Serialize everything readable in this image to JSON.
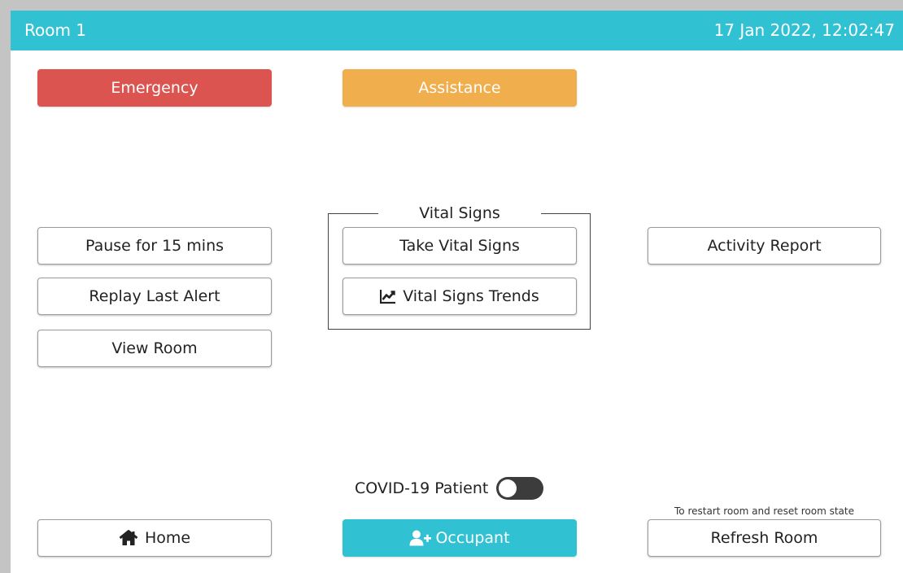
{
  "header": {
    "room": "Room 1",
    "datetime": "17 Jan 2022, 12:02:47"
  },
  "actions": {
    "emergency": "Emergency",
    "assistance": "Assistance"
  },
  "left": {
    "pause": "Pause for 15 mins",
    "replay": "Replay Last Alert",
    "view_room": "View Room"
  },
  "vital_signs": {
    "title": "Vital Signs",
    "take": "Take Vital Signs",
    "trends": "Vital Signs Trends"
  },
  "right": {
    "activity_report": "Activity Report"
  },
  "covid": {
    "label": "COVID-19 Patient",
    "enabled": false
  },
  "bottom": {
    "home": "Home",
    "occupant": "Occupant",
    "refresh_hint": "To restart room and reset room state",
    "refresh": "Refresh Room"
  },
  "colors": {
    "header": "#30c1d3",
    "emergency": "#dc5450",
    "assistance": "#f0ae4d",
    "occupant": "#30c1d3"
  },
  "icons": {
    "trends": "chart-line-icon",
    "home": "home-icon",
    "occupant": "user-plus-icon"
  }
}
